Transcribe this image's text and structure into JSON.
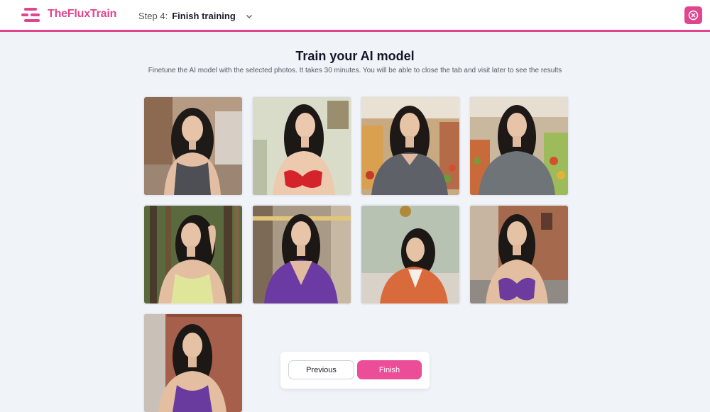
{
  "app": {
    "name": "TheFluxTrain",
    "accent": "#e0468e"
  },
  "header": {
    "step_prefix": "Step 4:",
    "step_name": "Finish training"
  },
  "main": {
    "title": "Train your AI model",
    "subtitle": "Finetune the AI model with the selected photos. It takes 30 minutes. You will be able to close the tab and visit later to see the results"
  },
  "photos": [
    {
      "scene": "cafe",
      "top": "tank top",
      "top_color": "#4d4f55"
    },
    {
      "scene": "indoor",
      "top": "bikini",
      "top_color": "#d4232a"
    },
    {
      "scene": "market",
      "top": "t-shirt",
      "top_color": "#5e6268"
    },
    {
      "scene": "market",
      "top": "long sleeve",
      "top_color": "#6f7479"
    },
    {
      "scene": "forest",
      "top": "tank top",
      "top_color": "#dfe69a"
    },
    {
      "scene": "store",
      "top": "v-neck",
      "top_color": "#6b3aa3"
    },
    {
      "scene": "living room",
      "top": "blazer",
      "top_color": "#d96a3c"
    },
    {
      "scene": "street",
      "top": "bikini",
      "top_color": "#6d3a9e"
    },
    {
      "scene": "brick wall",
      "top": "v-neck",
      "top_color": "#6a3b9e"
    }
  ],
  "footer": {
    "previous_label": "Previous",
    "finish_label": "Finish"
  }
}
